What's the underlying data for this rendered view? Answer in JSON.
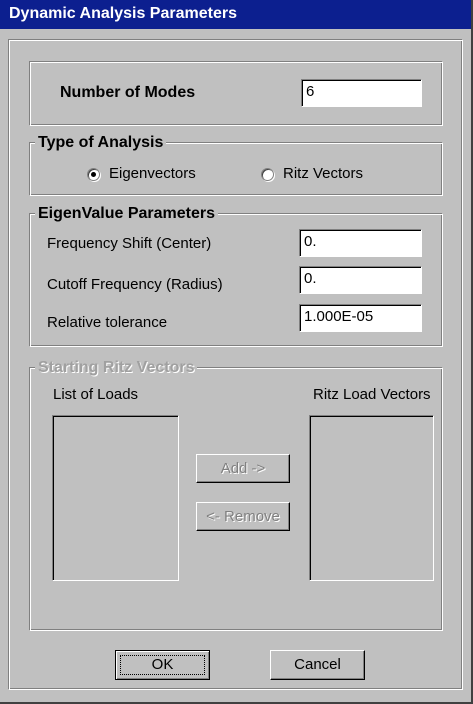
{
  "window": {
    "title": "Dynamic Analysis Parameters"
  },
  "modes": {
    "label": "Number of Modes",
    "value": "6"
  },
  "analysis_type": {
    "group_label": "Type of Analysis",
    "options": [
      {
        "label": "Eigenvectors",
        "selected": true
      },
      {
        "label": "Ritz Vectors",
        "selected": false
      }
    ]
  },
  "eigen": {
    "group_label": "EigenValue Parameters",
    "frequency_shift": {
      "label": "Frequency Shift  (Center)",
      "value": "0."
    },
    "cutoff_frequency": {
      "label": "Cutoff Frequency  (Radius)",
      "value": "0."
    },
    "relative_tolerance": {
      "label": "Relative tolerance",
      "value": "1.000E-05"
    }
  },
  "ritz": {
    "group_label": "Starting Ritz Vectors",
    "list_of_loads_label": "List of Loads",
    "ritz_load_vectors_label": "Ritz Load Vectors",
    "add_label": "Add ->",
    "remove_label": "<- Remove"
  },
  "footer": {
    "ok_label": "OK",
    "cancel_label": "Cancel"
  },
  "colors": {
    "titlebar": "#0c1f8f",
    "face": "#c0c0c0"
  }
}
